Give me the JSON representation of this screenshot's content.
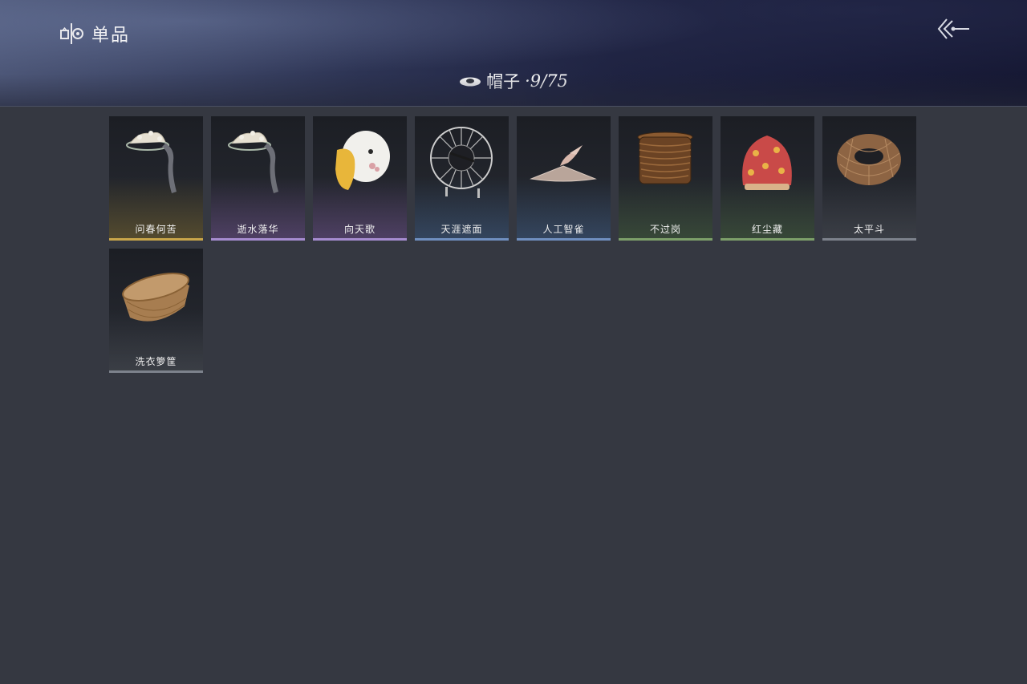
{
  "header": {
    "title": "单品",
    "title_icon": "wardrobe-icon",
    "back_icon": "back-arrow-icon"
  },
  "category": {
    "icon": "hat-icon",
    "label": "帽子",
    "count": "·9/75"
  },
  "items": [
    {
      "name": "问春何苦",
      "rarity": "gold",
      "color": "#c9a64a"
    },
    {
      "name": "逝水落华",
      "rarity": "purple",
      "color": "#a68cd0"
    },
    {
      "name": "向天歌",
      "rarity": "purple",
      "color": "#a68cd0"
    },
    {
      "name": "天涯遮面",
      "rarity": "blue",
      "color": "#6f8fc0"
    },
    {
      "name": "人工智雀",
      "rarity": "blue",
      "color": "#6f8fc0"
    },
    {
      "name": "不过岗",
      "rarity": "green",
      "color": "#7da06a"
    },
    {
      "name": "红尘藏",
      "rarity": "green",
      "color": "#7da06a"
    },
    {
      "name": "太平斗",
      "rarity": "gray",
      "color": "#7d828c"
    },
    {
      "name": "洗衣箩筐",
      "rarity": "gray",
      "color": "#7d828c"
    }
  ]
}
